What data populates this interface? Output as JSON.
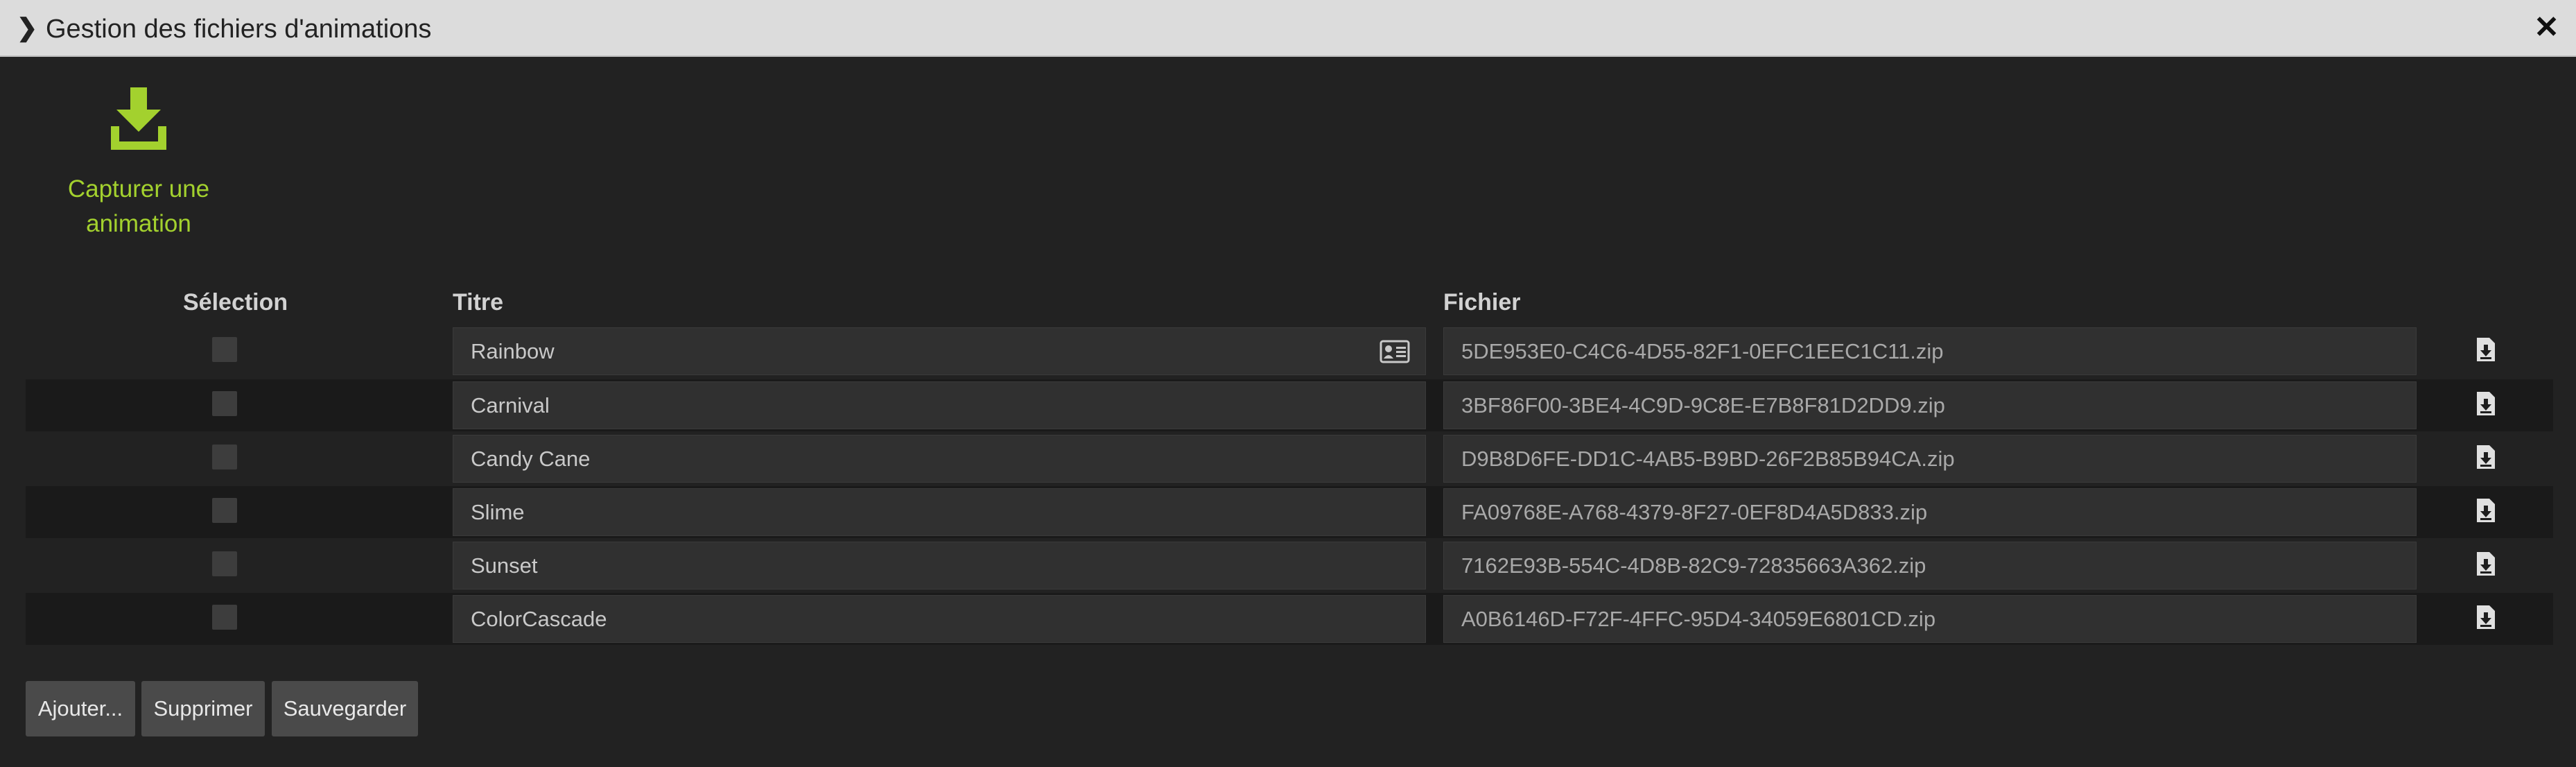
{
  "window": {
    "title": "Gestion des fichiers d'animations",
    "toggle_icon": "chevron-right-icon",
    "close_icon": "close-icon"
  },
  "capture": {
    "label_line1": "Capturer une",
    "label_line2": "animation",
    "icon": "download-icon",
    "accent_color": "#a3d12e"
  },
  "table": {
    "headers": {
      "selection": "Sélection",
      "title": "Titre",
      "file": "Fichier"
    },
    "rows": [
      {
        "title": "Rainbow",
        "file": "5DE953E0-C4C6-4D55-82F1-0EFC1EEC1C11.zip",
        "selected": false
      },
      {
        "title": "Carnival",
        "file": "3BF86F00-3BE4-4C9D-9C8E-E7B8F81D2DD9.zip",
        "selected": false
      },
      {
        "title": "Candy Cane",
        "file": "D9B8D6FE-DD1C-4AB5-B9BD-26F2B85B94CA.zip",
        "selected": false
      },
      {
        "title": "Slime",
        "file": "FA09768E-A768-4379-8F27-0EF8D4A5D833.zip",
        "selected": false
      },
      {
        "title": "Sunset",
        "file": "7162E93B-554C-4D8B-82C9-72835663A362.zip",
        "selected": false
      },
      {
        "title": "ColorCascade",
        "file": "A0B6146D-F72F-4FFC-95D4-34059E6801CD.zip",
        "selected": false
      }
    ]
  },
  "buttons": {
    "add": "Ajouter...",
    "delete": "Supprimer",
    "save": "Sauvegarder"
  }
}
